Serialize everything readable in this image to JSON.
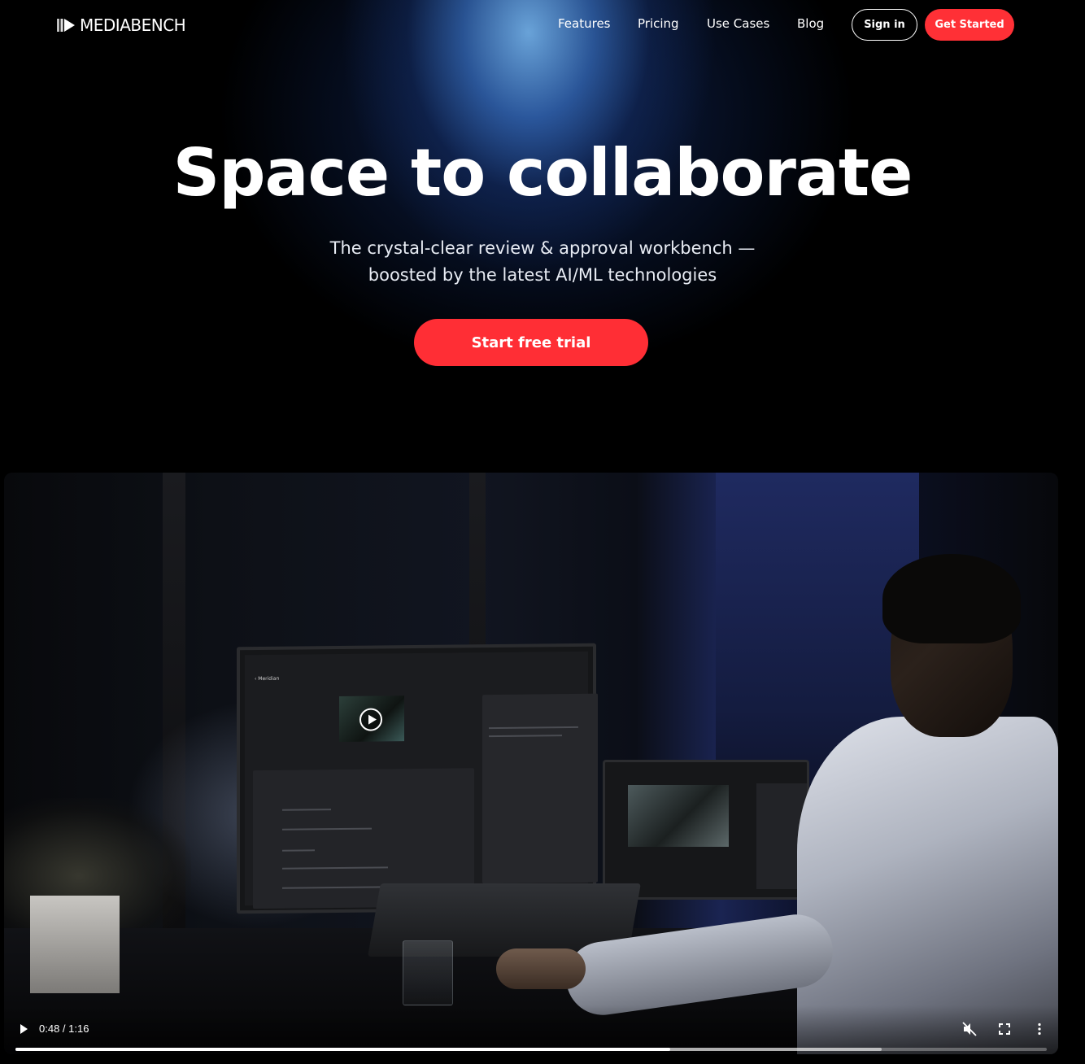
{
  "brand": {
    "name": "MEDIABENCH"
  },
  "nav": {
    "links": [
      "Features",
      "Pricing",
      "Use Cases",
      "Blog"
    ],
    "sign_in": "Sign in",
    "get_started": "Get Started"
  },
  "hero": {
    "headline": "Space to collaborate",
    "sub_line1": "The crystal-clear review & approval workbench —",
    "sub_line2": "boosted by the latest AI/ML technologies",
    "cta": "Start free trial"
  },
  "video": {
    "monitor_title": "‹ Meridian",
    "time": "0:48 / 1:16",
    "played_fraction": 0.635,
    "buffered_fraction": 0.84,
    "muted": true
  },
  "colors": {
    "accent": "#ff3036",
    "hero_glow": "#5f9fd8",
    "background": "#000000"
  },
  "icons": [
    "logo-icon",
    "play-icon",
    "mute-icon",
    "fullscreen-icon",
    "more-icon"
  ]
}
